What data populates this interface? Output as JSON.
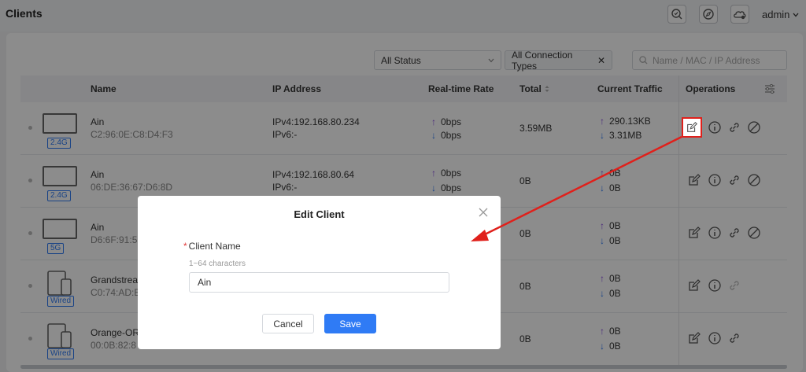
{
  "header": {
    "title": "Clients",
    "user": "admin"
  },
  "filters": {
    "status": "All Status",
    "connection": "All Connection Types",
    "search_placeholder": "Name / MAC / IP Address"
  },
  "columns": {
    "name": "Name",
    "ip": "IP Address",
    "rate": "Real-time Rate",
    "total": "Total",
    "traffic": "Current Traffic",
    "operations": "Operations"
  },
  "rows": [
    {
      "badge": "2.4G",
      "name": "Ain",
      "mac": "C2:96:0E:C8:D4:F3",
      "ipv4": "IPv4:192.168.80.234",
      "ipv6": "IPv6:-",
      "rate_up": "0bps",
      "rate_down": "0bps",
      "total": "3.59MB",
      "traffic_up": "290.13KB",
      "traffic_down": "3.31MB"
    },
    {
      "badge": "2.4G",
      "name": "Ain",
      "mac": "06:DE:36:67:D6:8D",
      "ipv4": "IPv4:192.168.80.64",
      "ipv6": "IPv6:-",
      "rate_up": "0bps",
      "rate_down": "0bps",
      "total": "0B",
      "traffic_up": "0B",
      "traffic_down": "0B"
    },
    {
      "badge": "5G",
      "name": "Ain",
      "mac": "D6:6F:91:55",
      "total": "0B",
      "traffic_up": "0B",
      "traffic_down": "0B"
    },
    {
      "badge": "Wired",
      "name": "Grandstrea",
      "mac": "C0:74:AD:B",
      "total": "0B",
      "traffic_up": "0B",
      "traffic_down": "0B"
    },
    {
      "badge": "Wired",
      "name": "Orange-OR",
      "mac": "00:0B:82:8",
      "total": "0B",
      "traffic_up": "0B",
      "traffic_down": "0B"
    }
  ],
  "modal": {
    "title": "Edit Client",
    "field_label": "Client Name",
    "required_mark": "*",
    "hint": "1~64 characters",
    "value": "Ain",
    "cancel_label": "Cancel",
    "save_label": "Save"
  },
  "colors": {
    "accent": "#2f7bf5",
    "upload": "#8a4fe0",
    "highlight": "#e0201b"
  }
}
